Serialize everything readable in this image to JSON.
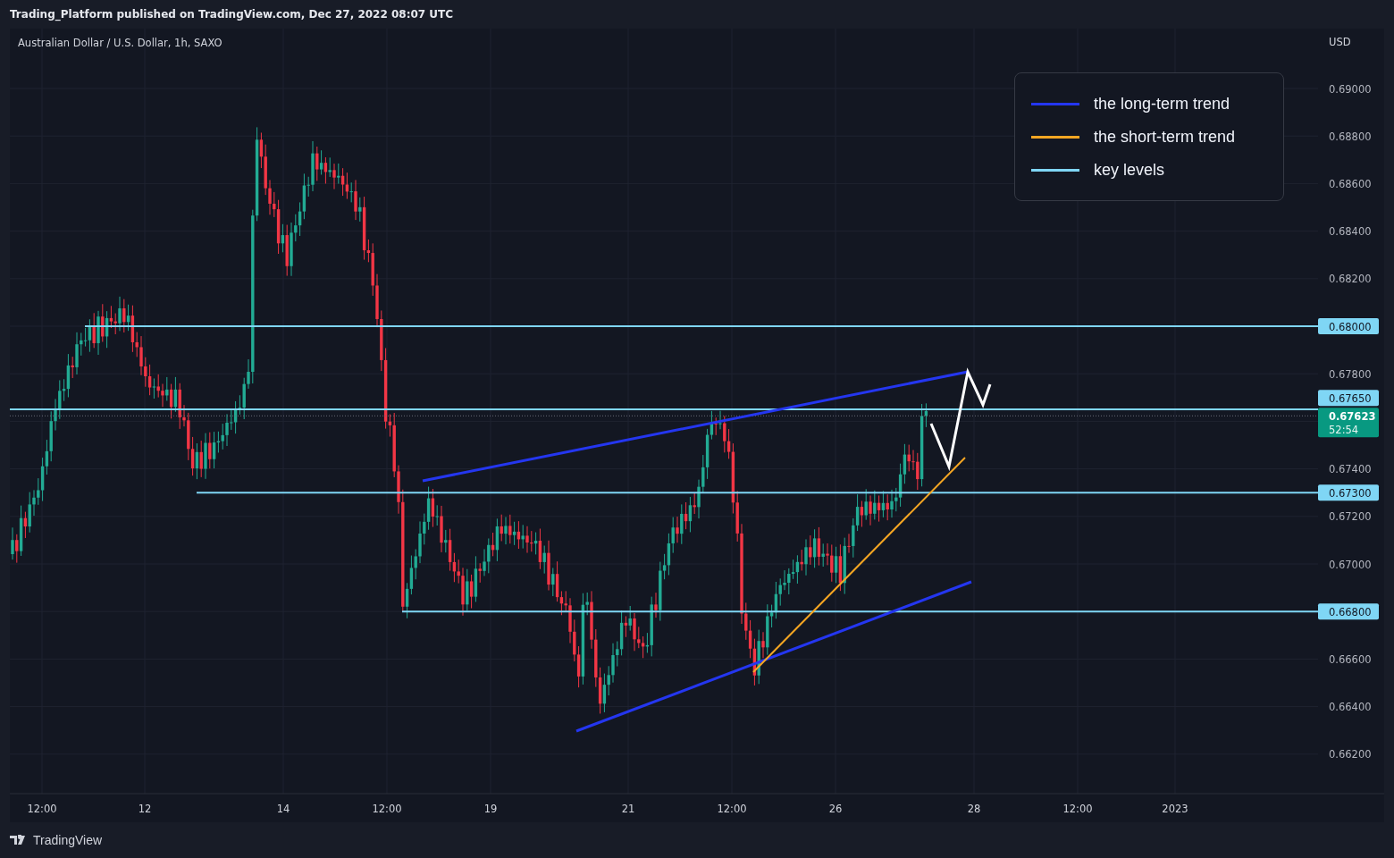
{
  "header": {
    "text": "Trading_Platform published on TradingView.com, Dec 27, 2022 08:07 UTC"
  },
  "chart": {
    "title": "Australian Dollar / U.S. Dollar, 1h, SAXO",
    "currency": "USD",
    "price_ticks": [
      "0.69000",
      "0.68800",
      "0.68600",
      "0.68400",
      "0.68200",
      "0.67800",
      "0.67400",
      "0.67200",
      "0.67000",
      "0.66600",
      "0.66400",
      "0.66200"
    ],
    "key_levels": [
      "0.68000",
      "0.67650",
      "0.67300",
      "0.66800"
    ],
    "current_price": {
      "price": "0.67623",
      "countdown": "52:54"
    },
    "time_labels": [
      "12:00",
      "12",
      "14",
      "12:00",
      "19",
      "21",
      "12:00",
      "26",
      "28",
      "12:00",
      "2023"
    ]
  },
  "legend": {
    "items": [
      {
        "label": "the long-term trend",
        "color": "#2436f0"
      },
      {
        "label": "the short-term trend",
        "color": "#f5a623"
      },
      {
        "label": "key levels",
        "color": "#7fd6f5"
      }
    ]
  },
  "footer": {
    "brand": "TradingView"
  }
}
